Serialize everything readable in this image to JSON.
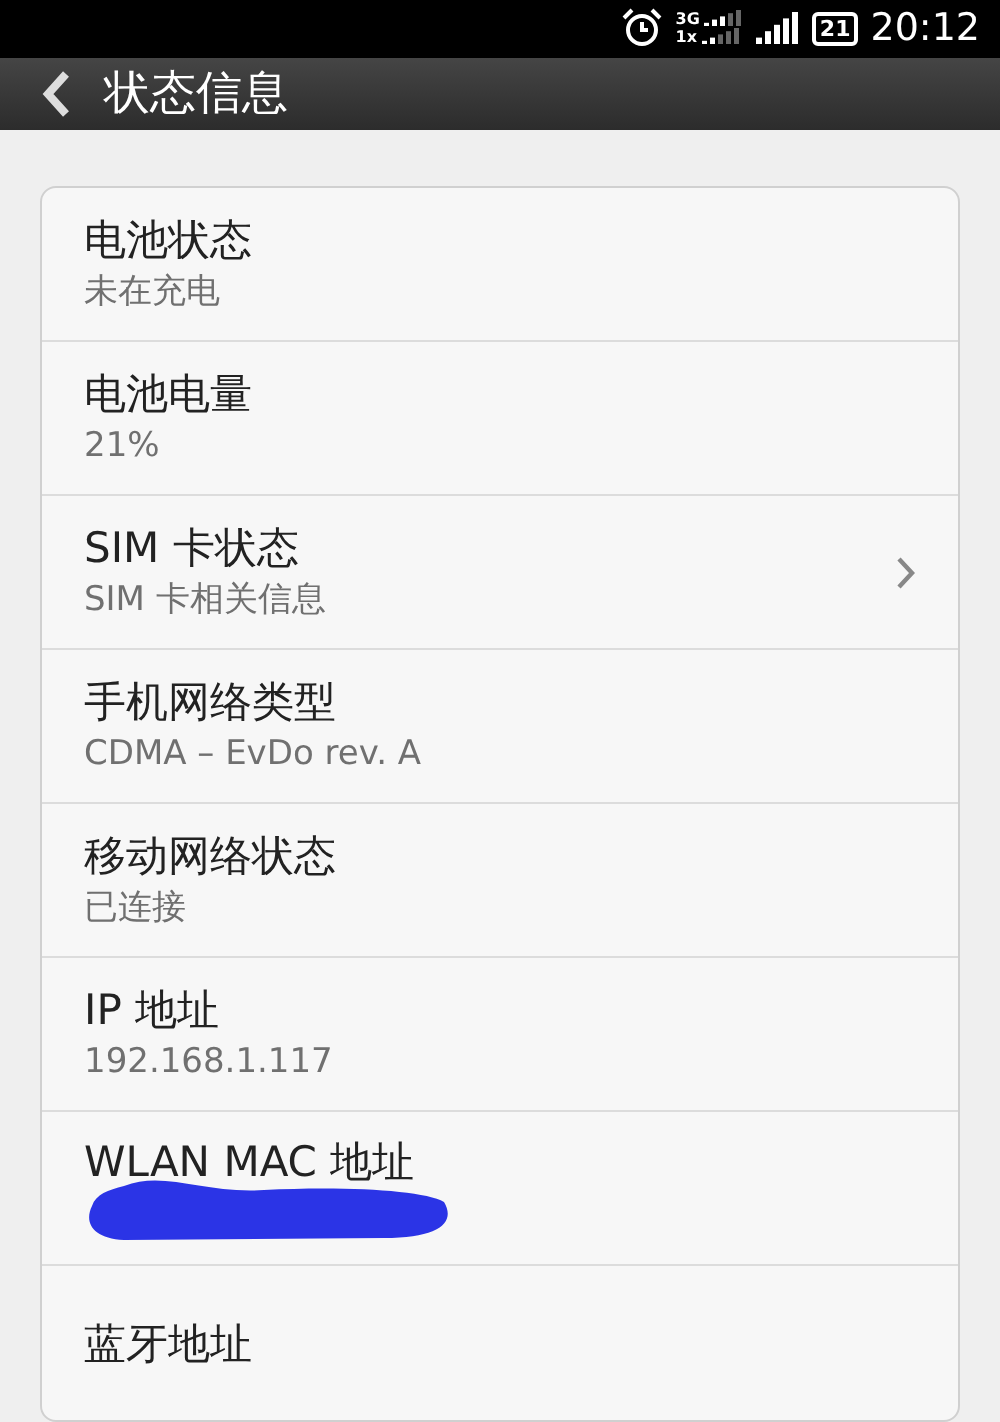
{
  "status_bar": {
    "network_top": "3G",
    "network_bottom": "1x",
    "battery": "21",
    "time": "20:12"
  },
  "header": {
    "title": "状态信息"
  },
  "rows": [
    {
      "kind": "info",
      "title": "电池状态",
      "value": "未在充电"
    },
    {
      "kind": "info",
      "title": "电池电量",
      "value": "21%"
    },
    {
      "kind": "link",
      "title": "SIM 卡状态",
      "value": "SIM 卡相关信息"
    },
    {
      "kind": "info",
      "title": "手机网络类型",
      "value": "CDMA – EvDo rev. A"
    },
    {
      "kind": "info",
      "title": "移动网络状态",
      "value": "已连接"
    },
    {
      "kind": "info",
      "title": "IP 地址",
      "value": "192.168.1.117"
    },
    {
      "kind": "redacted",
      "title": "WLAN MAC 地址"
    },
    {
      "kind": "info",
      "title": "蓝牙地址"
    }
  ]
}
